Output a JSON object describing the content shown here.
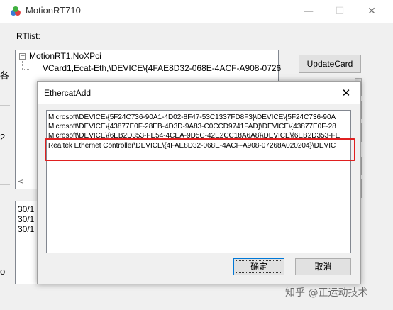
{
  "window": {
    "title": "MotionRT710",
    "minimize_glyph": "—",
    "maximize_glyph": "☐",
    "close_glyph": "✕"
  },
  "rtlist": {
    "label": "RTlist:",
    "expander_glyph": "−",
    "root": "MotionRT1,NoXPci",
    "child": "VCard1,Ecat-Eth,\\DEVICE\\{4FAE8D32-068E-4ACF-A908-0726",
    "scroll_left_glyph": "<"
  },
  "buttons": {
    "update_card": "UpdateCard"
  },
  "log": {
    "lines": [
      "30/1",
      "30/1",
      "30/1"
    ]
  },
  "left_edge": {
    "glyph_top": "各",
    "glyph_mid": "2",
    "glyph_bottom": "o"
  },
  "dialog": {
    "title": "EthercatAdd",
    "close_glyph": "✕",
    "devices": [
      "Microsoft\\DEVICE\\{5F24C736-90A1-4D02-8F47-53C1337FD8F3}\\DEVICE\\{5F24C736-90A",
      "Microsoft\\DEVICE\\{43877E0F-28EB-4D3D-9A83-C0CCD9741FAD}\\DEVICE\\{43877E0F-28",
      "Microsoft\\DEVICE\\{6EB2D353-FE54-4CEA-9D5C-42E2CC18A6A8}\\DEVICE\\{6EB2D353-FE",
      "Realtek Ethernet Controller\\DEVICE\\{4FAE8D32-068E-4ACF-A908-07268A020204}\\DEVIC"
    ],
    "ok_label": "确定",
    "cancel_label": "取消"
  },
  "watermark": "知乎 @正运动技术",
  "colors": {
    "highlight": "#e02020",
    "focus": "#0078d7"
  }
}
